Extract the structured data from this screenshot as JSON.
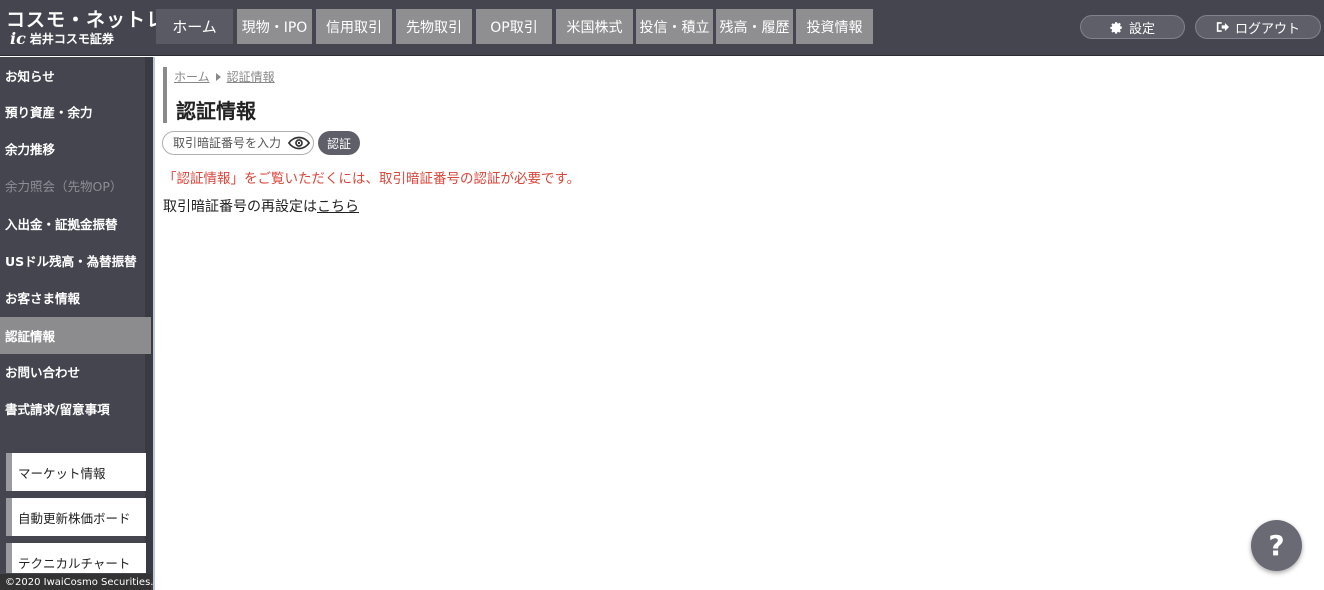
{
  "header": {
    "logo_line1": "コスモ・ネットレ",
    "logo_mark": "ic",
    "logo_line2": "岩井コスモ証券",
    "tabs": [
      {
        "label": "ホーム"
      },
      {
        "label": "現物・IPO"
      },
      {
        "label": "信用取引"
      },
      {
        "label": "先物取引"
      },
      {
        "label": "OP取引"
      },
      {
        "label": "米国株式"
      },
      {
        "label": "投信・積立"
      },
      {
        "label": "残高・履歴"
      },
      {
        "label": "投資情報"
      }
    ],
    "settings_label": "設定",
    "logout_label": "ログアウト",
    "settings_icon": "gear-icon",
    "logout_icon": "logout-icon"
  },
  "sidebar": {
    "items": [
      {
        "label": "お知らせ"
      },
      {
        "label": "預り資産・余力"
      },
      {
        "label": "余力推移"
      },
      {
        "label": "余力照会（先物OP）"
      },
      {
        "label": "入出金・証拠金振替"
      },
      {
        "label": "USドル残高・為替振替"
      },
      {
        "label": "お客さま情報"
      },
      {
        "label": "認証情報"
      },
      {
        "label": "お問い合わせ"
      },
      {
        "label": "書式請求/留意事項"
      }
    ],
    "boxes": [
      {
        "label": "マーケット情報"
      },
      {
        "label": "自動更新株価ボード"
      },
      {
        "label": "テクニカルチャート"
      }
    ],
    "copyright": "©2020 IwaiCosmo Securities."
  },
  "main": {
    "breadcrumb": {
      "home": "ホーム",
      "current": "認証情報"
    },
    "title": "認証情報",
    "pin_placeholder": "取引暗証番号を入力",
    "auth_button": "認証",
    "warning": "「認証情報」をご覧いただくには、取引暗証番号の認証が必要です。",
    "reset_text": "取引暗証番号の再設定は",
    "reset_link": "こちら"
  },
  "help_label": "?",
  "colors": {
    "header_bg": "#45454f",
    "tab_bg": "#8f8f91",
    "active_sidebar_bg": "#8c8c8e",
    "warning": "#d9463b"
  }
}
